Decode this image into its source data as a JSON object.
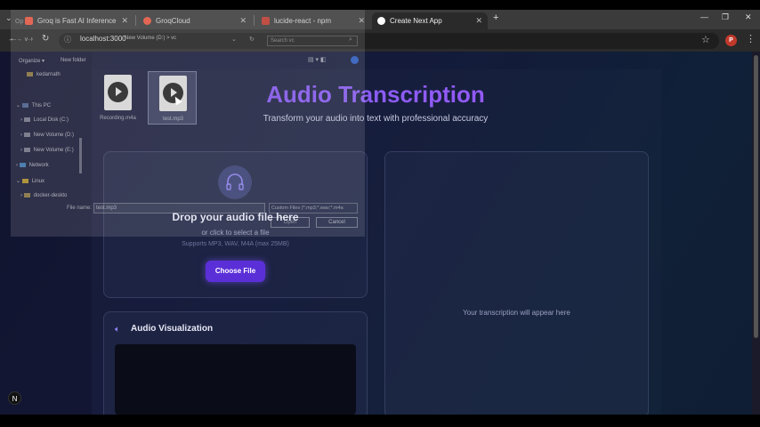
{
  "browser": {
    "tabs": [
      {
        "label": "Groq is Fast AI Inference",
        "color": "#e8553d"
      },
      {
        "label": "GroqCloud",
        "color": "#e8553d"
      },
      {
        "label": "lucide-react - npm",
        "color": "#c0392b"
      },
      {
        "label": "Create Next App",
        "color": "#ffffff"
      }
    ],
    "url": "localhost:3000",
    "profile_initial": "P"
  },
  "dialog": {
    "title": "Op",
    "address": "New Volume (D:)  >  vc",
    "search_placeholder": "Search vc",
    "organize_label": "Organize ▾",
    "new_folder_label": "New folder",
    "tree": [
      "kedarnath",
      "This PC",
      "Local Disk (C:)",
      "New Volume (D:)",
      "New Volume (E:)",
      "Network",
      "Linux",
      "docker-deskto"
    ],
    "files": [
      {
        "name": "Recording.m4a"
      },
      {
        "name": "test.mp3"
      }
    ],
    "file_name_label": "File name:",
    "file_name_value": "test.mp3",
    "filter_value": "Custom Files (*.mp3;*.wav;*.m4a",
    "open_label": "Open",
    "cancel_label": "Cancel"
  },
  "app": {
    "title": "Audio Transcription",
    "subtitle": "Transform your audio into text with professional accuracy",
    "upload": {
      "heading": "Drop your audio file here",
      "sub": "or click to select a file",
      "hint": "Supports MP3, WAV, M4A (max 25MB)",
      "button": "Choose File"
    },
    "visualization": {
      "heading": "Audio Visualization"
    },
    "transcription": {
      "placeholder": "Your transcription will appear here"
    }
  },
  "next_badge": "N"
}
